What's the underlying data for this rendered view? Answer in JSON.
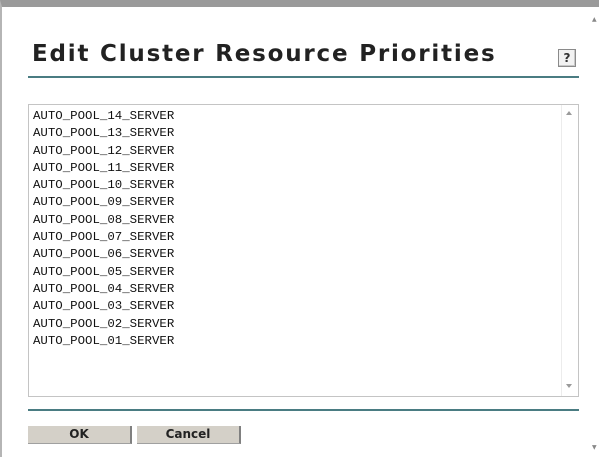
{
  "dialog": {
    "title": "Edit Cluster Resource Priorities",
    "help_label": "?"
  },
  "resources": [
    "AUTO_POOL_14_SERVER",
    "AUTO_POOL_13_SERVER",
    "AUTO_POOL_12_SERVER",
    "AUTO_POOL_11_SERVER",
    "AUTO_POOL_10_SERVER",
    "AUTO_POOL_09_SERVER",
    "AUTO_POOL_08_SERVER",
    "AUTO_POOL_07_SERVER",
    "AUTO_POOL_06_SERVER",
    "AUTO_POOL_05_SERVER",
    "AUTO_POOL_04_SERVER",
    "AUTO_POOL_03_SERVER",
    "AUTO_POOL_02_SERVER",
    "AUTO_POOL_01_SERVER"
  ],
  "buttons": {
    "ok_label": "OK",
    "cancel_label": "Cancel"
  },
  "colors": {
    "accent_rule": "#4a7c82",
    "button_face": "#d4d0c8"
  },
  "icons": {
    "help": "help-icon",
    "scroll_up": "scroll-up-arrow-icon",
    "scroll_down": "scroll-down-arrow-icon"
  }
}
